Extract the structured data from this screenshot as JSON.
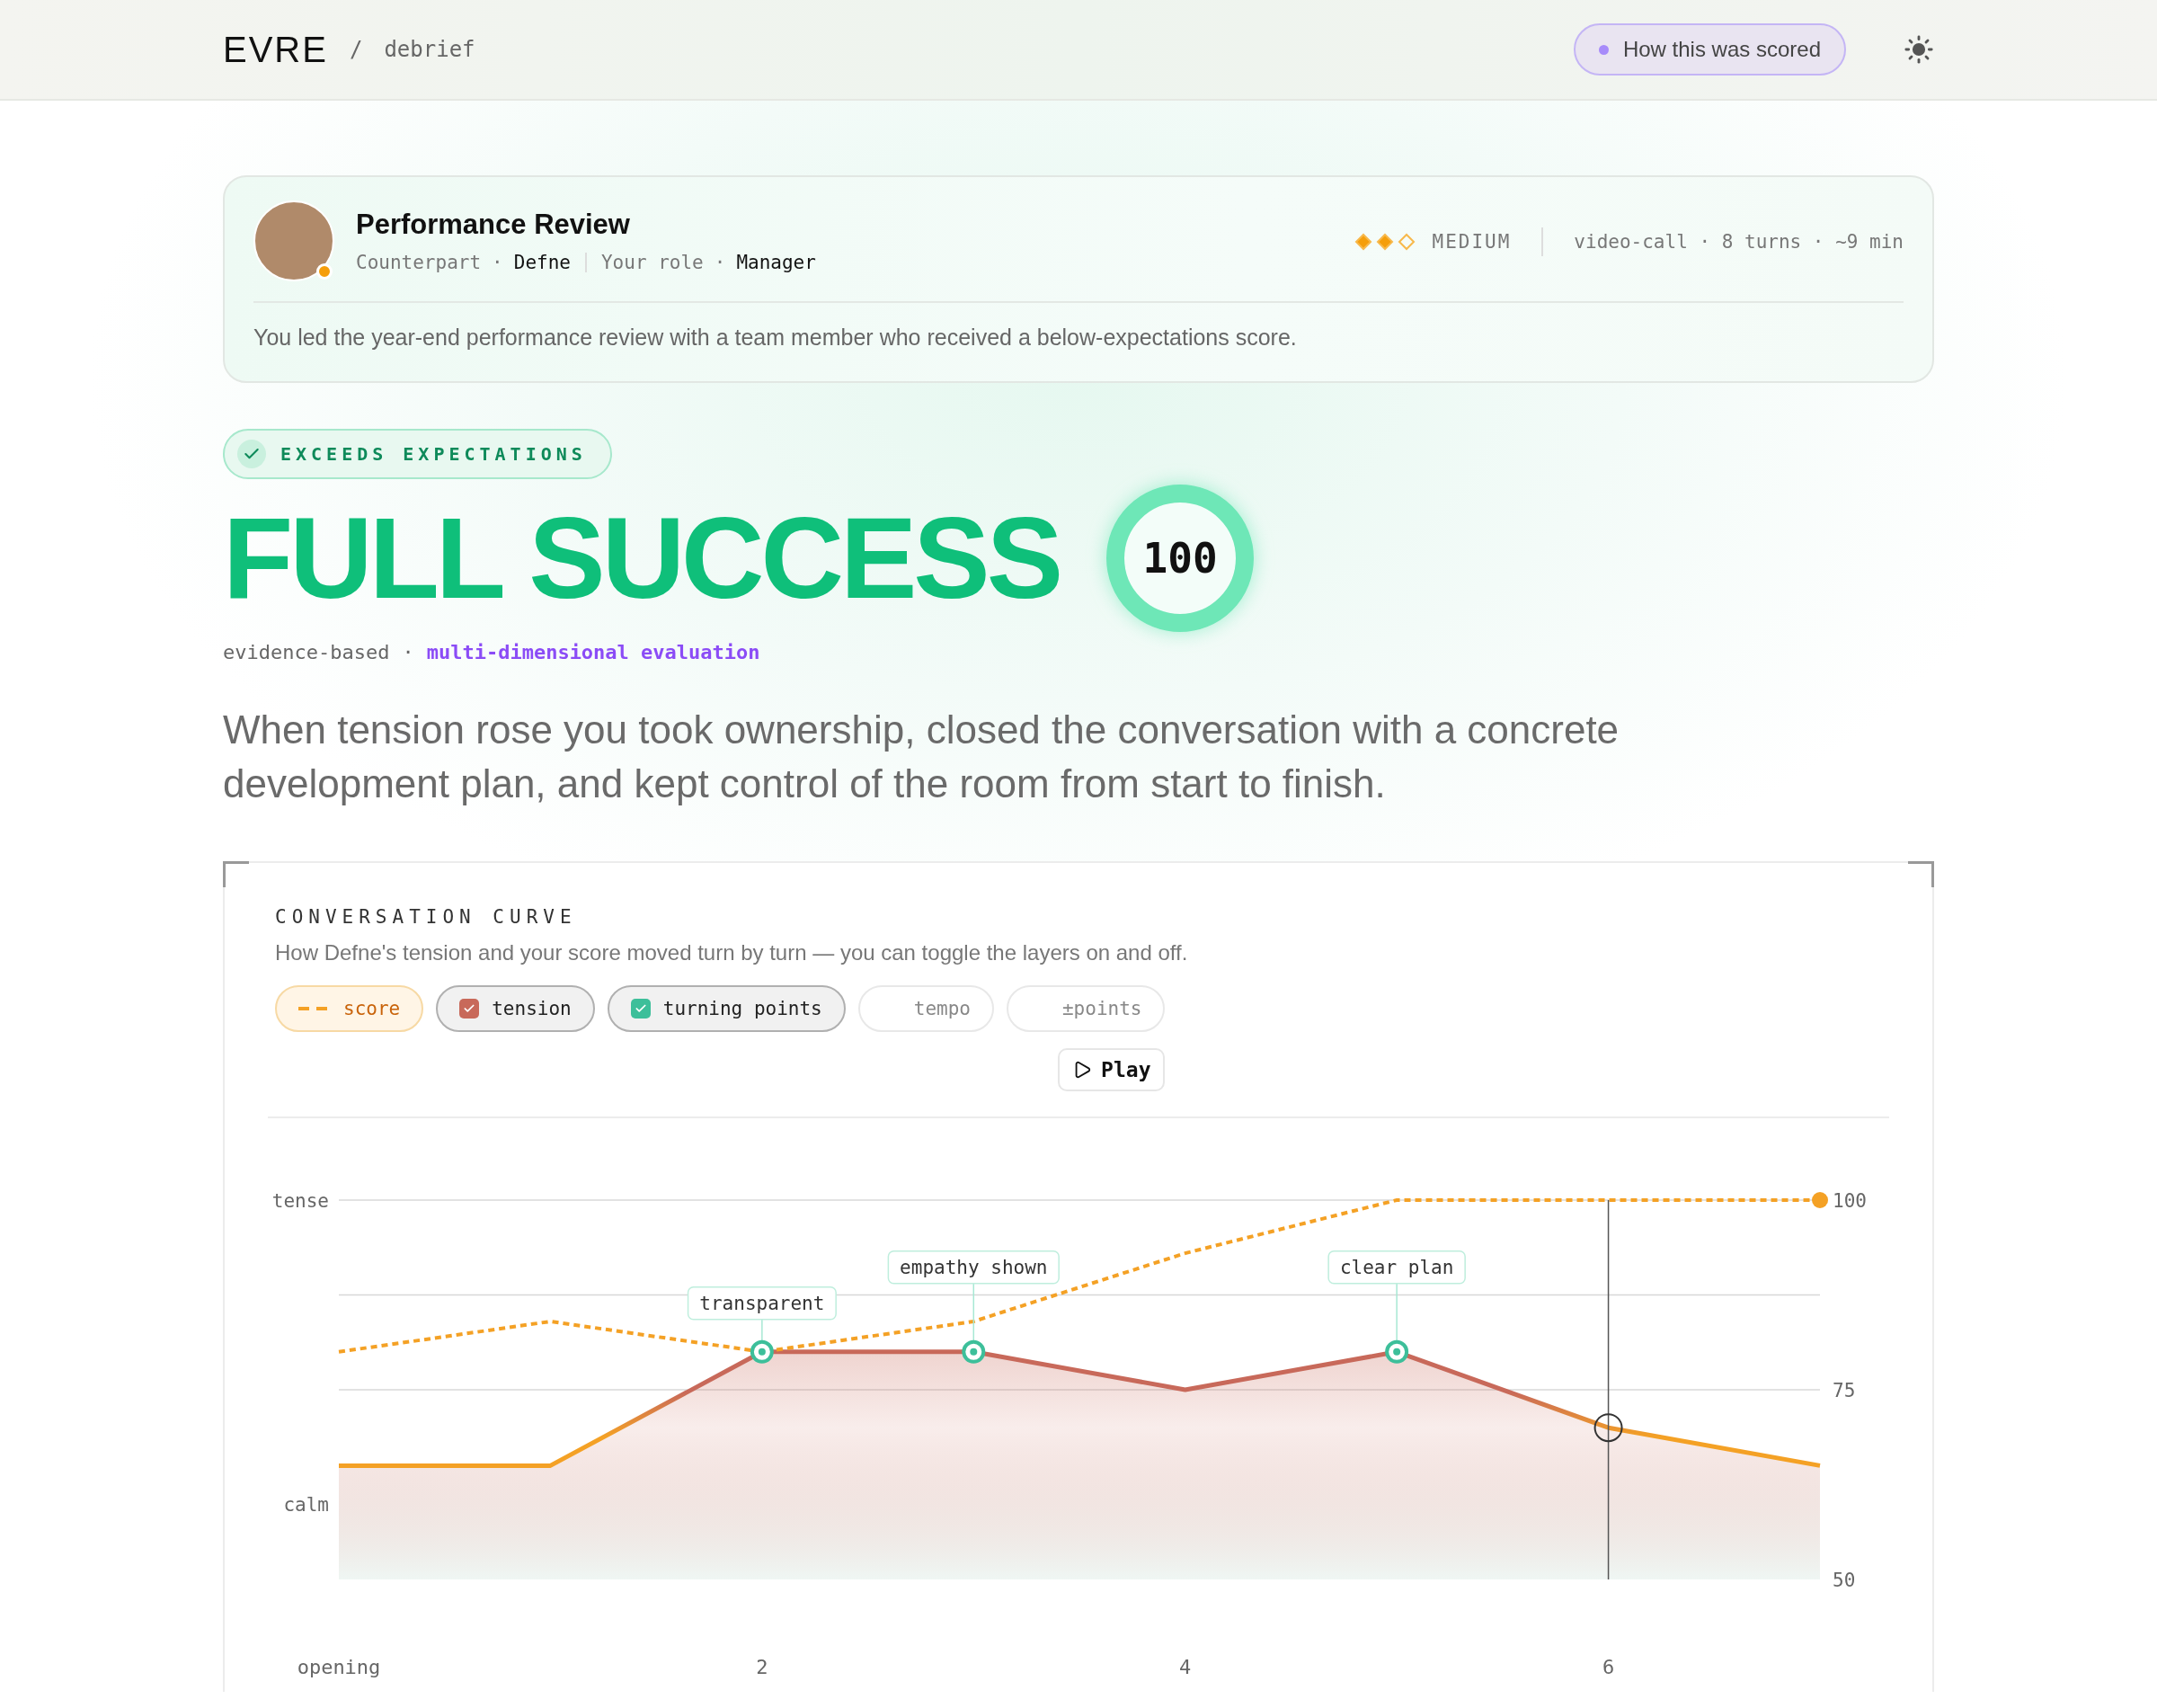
{
  "header": {
    "logo": "EVRE",
    "breadcrumb_separator": "/",
    "breadcrumb": "debrief",
    "scoring_button": "How this was scored"
  },
  "scenario": {
    "title": "Performance Review",
    "separator": "·",
    "meta": [
      {
        "label": "Counterpart",
        "value": "Defne"
      },
      {
        "label": "Your role",
        "value": "Manager"
      }
    ],
    "difficulty": {
      "stars": 2,
      "label": "MEDIUM"
    },
    "details": "video-call · 8 turns · ~9 min",
    "description": "You led the year-end performance review with a team member who received a below-expectations score."
  },
  "verdict": {
    "badge": "EXCEEDS EXPECTATIONS",
    "title": "FULL SUCCESS",
    "score": "100",
    "level": 1,
    "method_prefix": "evidence-based",
    "method_separator": "·",
    "method_link": "multi-dimensional evaluation",
    "summary": "When tension rose you took ownership, closed the conversation with a concrete development plan, and kept control of the room from start to finish."
  },
  "curve": {
    "heading": "CONVERSATION CURVE",
    "description": "How Defne's tension and your score moved turn by turn — you can toggle the layers on and off.",
    "layers": [
      {
        "kind": "series-line"
      },
      {
        "kind": "series-toggle",
        "checked": true
      },
      {
        "kind": "checkbox",
        "label": "turning points",
        "checked": true,
        "color": "#3dbf9a"
      },
      {
        "kind": "checkbox",
        "label": "tempo",
        "checked": false
      },
      {
        "kind": "checkbox",
        "label": "±points",
        "checked": false
      }
    ],
    "play_button": "Play",
    "tension_labels": [
      "tense",
      "calm"
    ],
    "chart_data": {
      "type": "line",
      "x": [
        0,
        1,
        2,
        3,
        4,
        5,
        6,
        7
      ],
      "series": [
        {
          "name": "score",
          "color": "#f4a125",
          "line_style": "dashed",
          "values": [
            80,
            84,
            80,
            84,
            93,
            100,
            100,
            100
          ]
        },
        {
          "name": "tension",
          "color": "#c8695a",
          "type": "area",
          "values": [
            65,
            65,
            80,
            80,
            75,
            80,
            70,
            65
          ]
        }
      ],
      "xlim": [
        0,
        7
      ],
      "ylim": [
        50,
        100
      ],
      "xticks": [
        {
          "value": 0,
          "label": "opening"
        },
        2,
        4,
        6
      ],
      "yticks": [
        50,
        75,
        100
      ],
      "annotations": [
        "transparent",
        "empathy shown",
        "clear plan"
      ],
      "ref_lines": [
        {
          "axis": "x",
          "value": 6
        },
        {
          "axis": "y",
          "value": 75
        },
        {
          "axis": "y",
          "value": 87.5
        },
        {
          "axis": "y",
          "value": 100
        }
      ]
    }
  }
}
